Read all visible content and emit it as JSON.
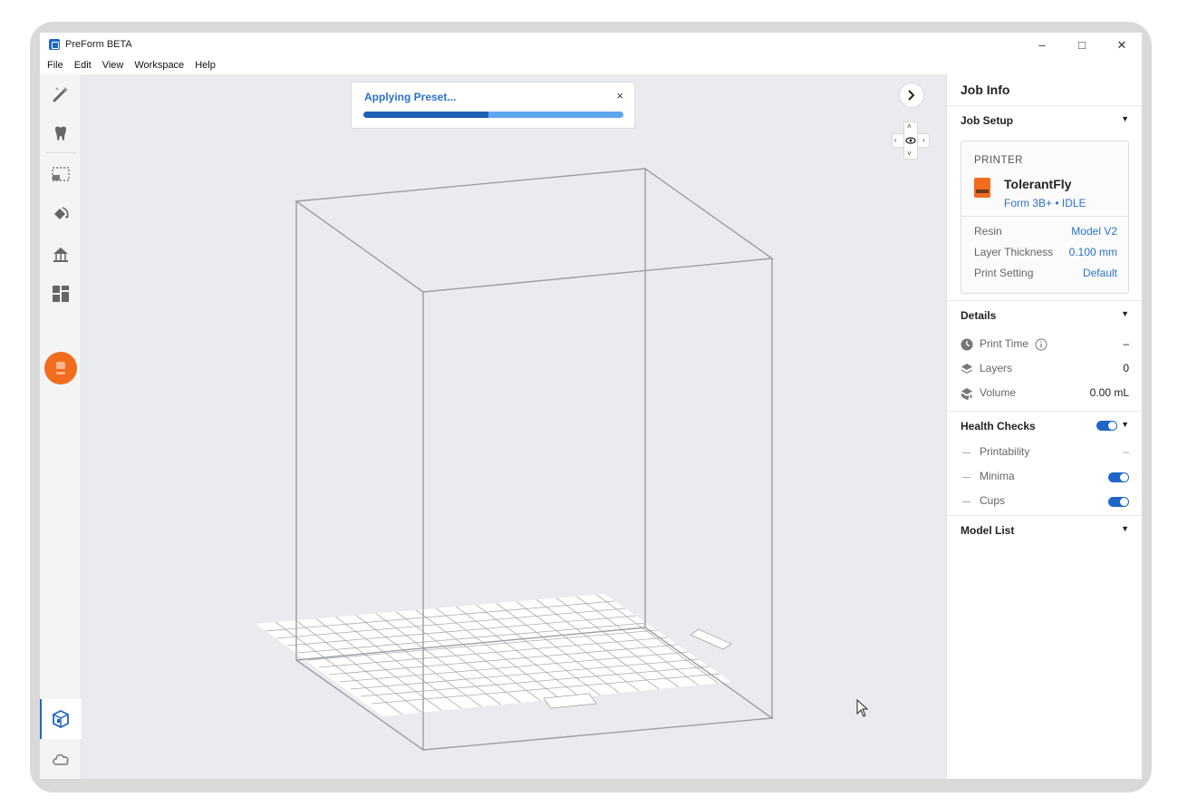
{
  "window": {
    "title": "PreForm BETA",
    "controls": {
      "minimize": "–",
      "maximize": "□",
      "close": "✕"
    }
  },
  "menu": [
    "File",
    "Edit",
    "View",
    "Workspace",
    "Help"
  ],
  "toolbar": {
    "tools": [
      "magic-wand-icon",
      "tooth-icon",
      "selection-icon",
      "orient-icon",
      "supports-icon",
      "layout-icon",
      "print-icon"
    ],
    "bottom": [
      "local-printer-icon",
      "cloud-icon",
      "account-icon"
    ],
    "active_tool": "print-icon",
    "accent_color": "#f26c1e"
  },
  "toast": {
    "title": "Applying Preset...",
    "close": "×",
    "progress": 0.48
  },
  "view_controls": {
    "expand": "›",
    "zoom_in": "+",
    "zoom_out": "–"
  },
  "panel": {
    "title": "Job Info",
    "job_setup": {
      "label": "Job Setup",
      "printer_label": "PRINTER",
      "printer_name": "TolerantFly",
      "printer_model": "Form 3B+ • IDLE",
      "rows": [
        {
          "key": "Resin",
          "value": "Model V2"
        },
        {
          "key": "Layer Thickness",
          "value": "0.100 mm"
        },
        {
          "key": "Print Setting",
          "value": "Default"
        }
      ]
    },
    "details": {
      "label": "Details",
      "rows": [
        {
          "key": "Print Time",
          "value": "–"
        },
        {
          "key": "Layers",
          "value": "0"
        },
        {
          "key": "Volume",
          "value": "0.00 mL"
        }
      ]
    },
    "health_checks": {
      "label": "Health Checks",
      "enabled": true,
      "rows": [
        {
          "key": "Printability",
          "value": "–"
        },
        {
          "key": "Minima",
          "enabled": true
        },
        {
          "key": "Cups",
          "enabled": true
        }
      ]
    },
    "model_list": {
      "label": "Model List"
    }
  }
}
